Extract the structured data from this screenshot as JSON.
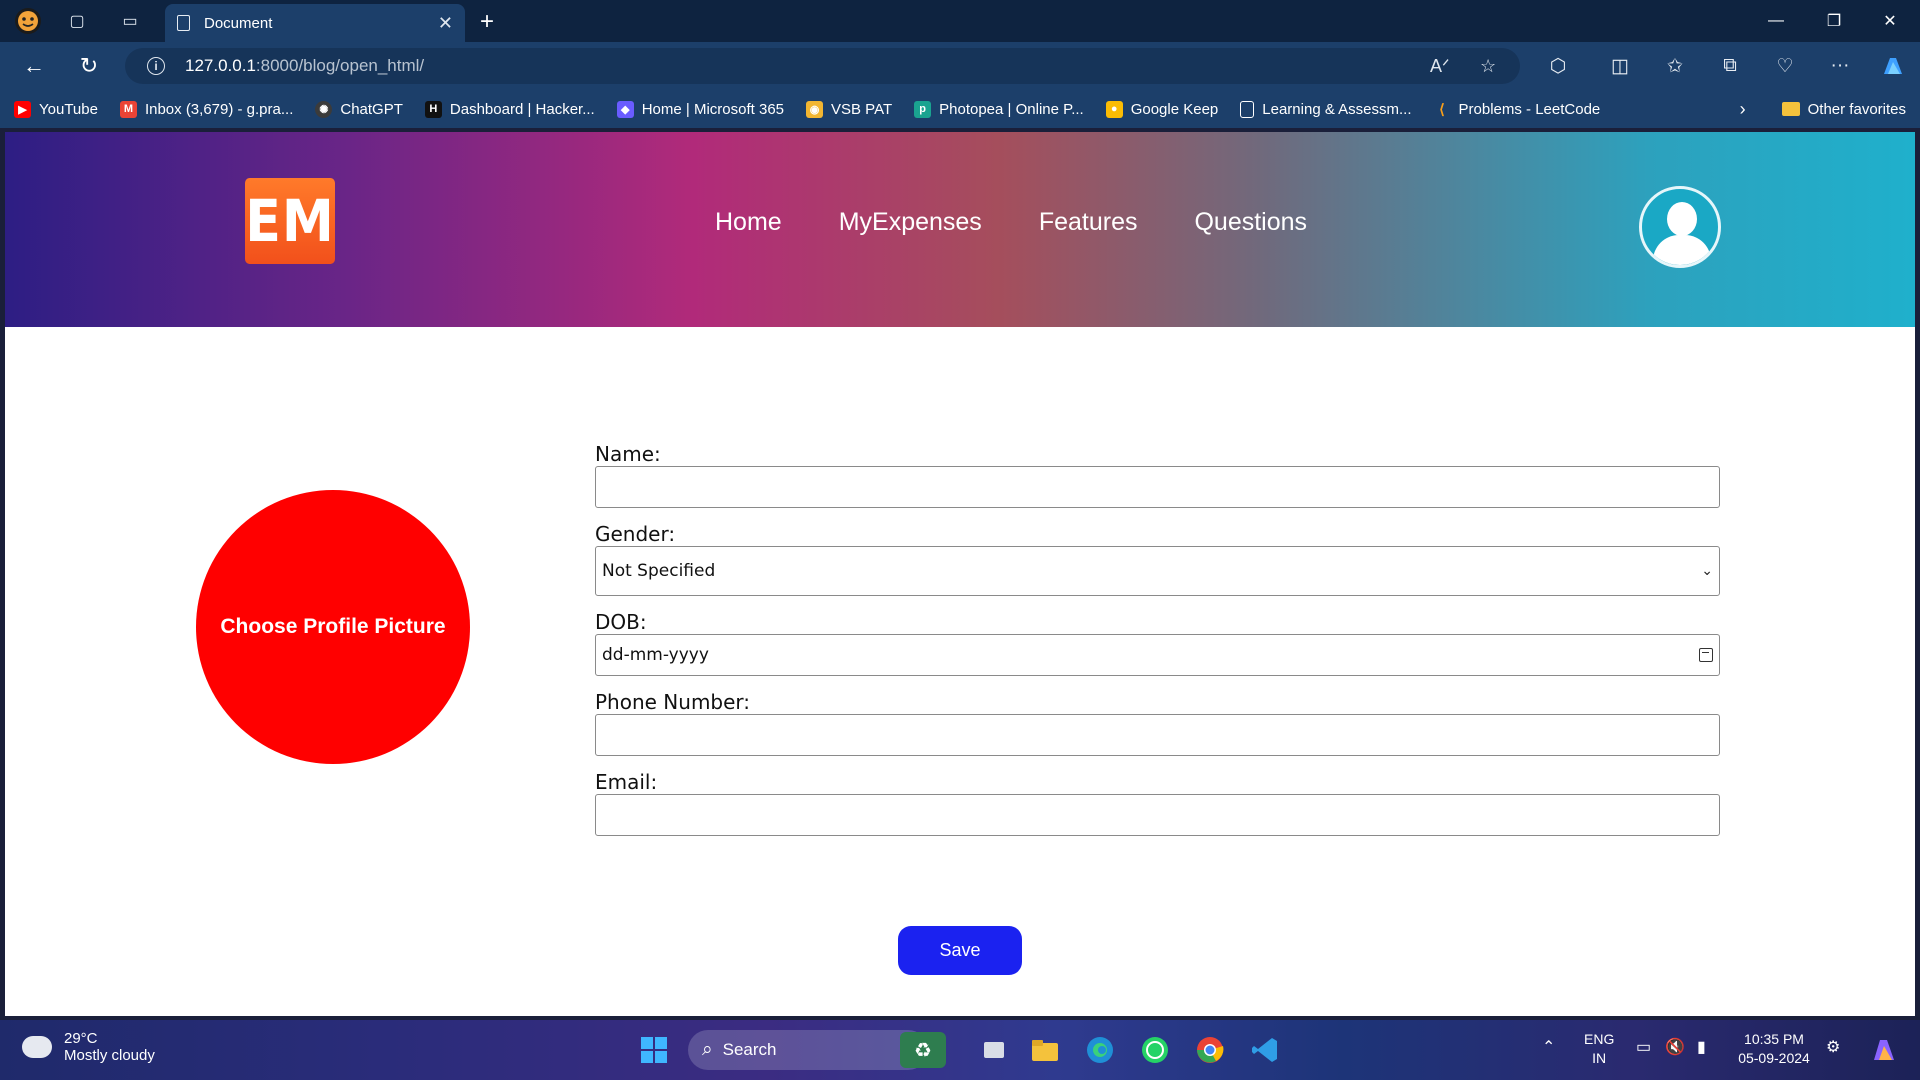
{
  "browser": {
    "tab_title": "Document",
    "url_host": "127.0.0.1",
    "url_rest": ":8000/blog/open_html/",
    "bookmarks": [
      {
        "label": "YouTube",
        "color": "#ff0000"
      },
      {
        "label": "Inbox (3,679) - g.pra...",
        "color": "#ea4335"
      },
      {
        "label": "ChatGPT",
        "color": "#3b3b3b"
      },
      {
        "label": "Dashboard | Hacker...",
        "color": "#111111"
      },
      {
        "label": "Home | Microsoft 365",
        "color": "#6a5cff"
      },
      {
        "label": "VSB PAT",
        "color": "#f2b632"
      },
      {
        "label": "Photopea | Online P...",
        "color": "#1aa390"
      },
      {
        "label": "Google Keep",
        "color": "#fbbc04"
      },
      {
        "label": "Learning & Assessm...",
        "color": "#5a6b80"
      },
      {
        "label": "Problems - LeetCode",
        "color": "#f89f1b"
      }
    ],
    "other_favorites": "Other favorites"
  },
  "page": {
    "logo_text": "EM",
    "nav": [
      "Home",
      "MyExpenses",
      "Features",
      "Questions"
    ],
    "profile_picture_label": "Choose Profile Picture",
    "form": {
      "name_label": "Name:",
      "name_value": "",
      "gender_label": "Gender:",
      "gender_value": "Not Specified",
      "dob_label": "DOB:",
      "dob_placeholder": "dd-mm-yyyy",
      "phone_label": "Phone Number:",
      "phone_value": "",
      "email_label": "Email:",
      "email_value": ""
    },
    "save_label": "Save"
  },
  "taskbar": {
    "temperature": "29°C",
    "weather": "Mostly cloudy",
    "search_label": "Search",
    "lang_top": "ENG",
    "lang_bottom": "IN",
    "time": "10:35 PM",
    "date": "05-09-2024"
  }
}
